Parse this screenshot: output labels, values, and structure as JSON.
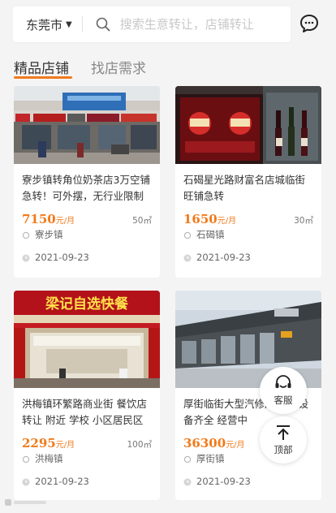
{
  "header": {
    "city": "东莞市",
    "search_placeholder": "搜索生意转让，店铺转让"
  },
  "tabs": [
    {
      "label": "精品店铺",
      "active": true
    },
    {
      "label": "找店需求",
      "active": false
    }
  ],
  "listings": [
    {
      "title": "寮步镇转角位奶茶店3万空铺急转！可外摆，无行业限制",
      "price": "7150",
      "price_unit": "元/月",
      "area": "50㎡",
      "location": "寮步镇",
      "date": "2021-09-23"
    },
    {
      "title": "石碣星光路财富名店城临街旺铺急转",
      "price": "1650",
      "price_unit": "元/月",
      "area": "30㎡",
      "location": "石碣镇",
      "date": "2021-09-23"
    },
    {
      "title": "洪梅镇环繁路商业街 餐饮店转让 附近 学校 小区居民区",
      "price": "2295",
      "price_unit": "元/月",
      "area": "100㎡",
      "location": "洪梅镇",
      "date": "2021-09-23",
      "sign_text": "梁记自选快餐"
    },
    {
      "title": "厚街临街大型汽修厂转让 设备齐全 经营中",
      "price": "36300",
      "price_unit": "元/月",
      "area": "",
      "location": "厚街镇",
      "date": "2021-09-23"
    }
  ],
  "float_buttons": {
    "service_label": "客服",
    "top_label": "顶部"
  },
  "colors": {
    "accent": "#f27a1a",
    "background": "#f4f4f4"
  }
}
